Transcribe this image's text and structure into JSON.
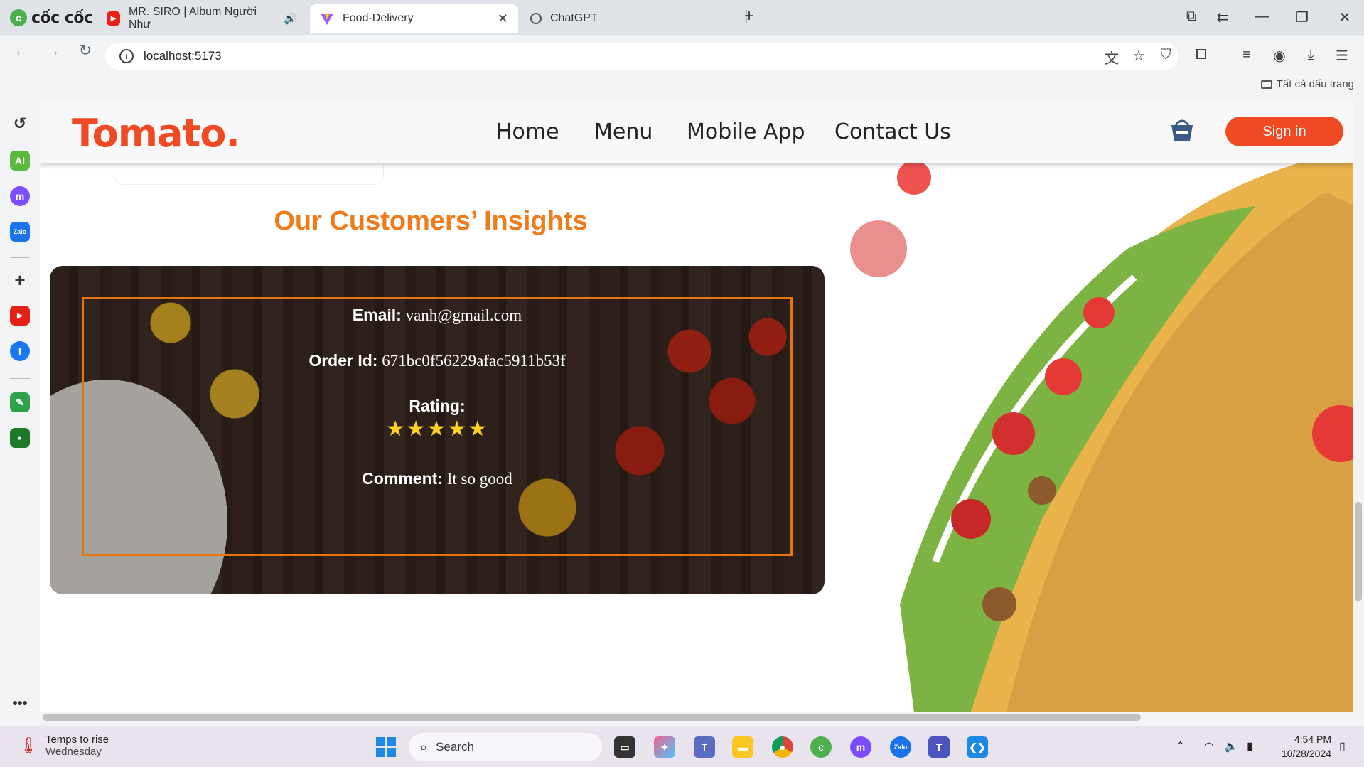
{
  "browser": {
    "brand": "cốc cốc",
    "tabs": [
      {
        "label": "MR. SIRO | Album Người Như",
        "icon": "youtube-icon"
      },
      {
        "label": "Food-Delivery",
        "icon": "vite-icon",
        "active": true
      },
      {
        "label": "ChatGPT",
        "icon": "chatgpt-icon"
      }
    ],
    "url": "localhost:5173",
    "bookmarks_label": "Tất cả dấu trang"
  },
  "site": {
    "logo": "Tomato.",
    "menu": [
      "Home",
      "Menu",
      "Mobile App",
      "Contact Us"
    ],
    "signin_label": "Sign in",
    "heading": "Our Customers’ Insights",
    "insight": {
      "email_label": "Email:",
      "email_value": "vanh@gmail.com",
      "order_label": "Order Id:",
      "order_value": "671bc0f56229afac5911b53f",
      "rating_label": "Rating:",
      "rating_stars": "★★★★★",
      "rating_value": 5,
      "comment_label": "Comment:",
      "comment_value": "It so good"
    }
  },
  "taskbar": {
    "weather_title": "Temps to rise",
    "weather_day": "Wednesday",
    "search_placeholder": "Search",
    "time": "4:54 PM",
    "date": "10/28/2024"
  },
  "colors": {
    "brand_orange": "#f04a24",
    "heading_orange": "#f07b1a",
    "star_yellow": "#ffd21f"
  }
}
